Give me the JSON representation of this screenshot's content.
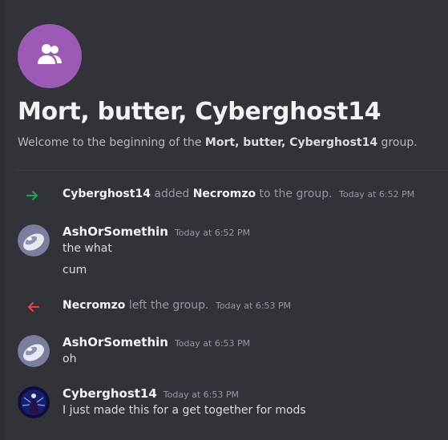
{
  "group": {
    "title": "Mort, butter, Cyberghost14",
    "welcome_prefix": "Welcome to the beginning of the ",
    "welcome_name": "Mort, butter, Cyberghost14",
    "welcome_suffix": " group.",
    "avatar_color": "#9c59b6",
    "icon": "group-users-icon"
  },
  "messages": [
    {
      "type": "system-join",
      "icon": "arrow-right-icon",
      "actor": "Cyberghost14",
      "verb": " added ",
      "target": "Necromzo",
      "tail": " to the group.",
      "timestamp": "Today at 6:52 PM",
      "color": "#23a55a"
    },
    {
      "type": "message",
      "author": "AshOrSomethin",
      "timestamp": "Today at 6:52 PM",
      "lines": [
        "the what",
        "cum"
      ],
      "avatar": "discord-default-avatar"
    },
    {
      "type": "system-leave",
      "icon": "arrow-left-icon",
      "actor": "Necromzo",
      "tail": " left the group.",
      "timestamp": "Today at 6:53 PM",
      "color": "#f23f43"
    },
    {
      "type": "message",
      "author": "AshOrSomethin",
      "timestamp": "Today at 6:53 PM",
      "lines": [
        "oh"
      ],
      "avatar": "discord-default-avatar"
    },
    {
      "type": "message",
      "author": "Cyberghost14",
      "timestamp": "Today at 6:53 PM",
      "lines": [
        "I just made this for a get together for mods"
      ],
      "avatar": "user-avatar"
    }
  ]
}
